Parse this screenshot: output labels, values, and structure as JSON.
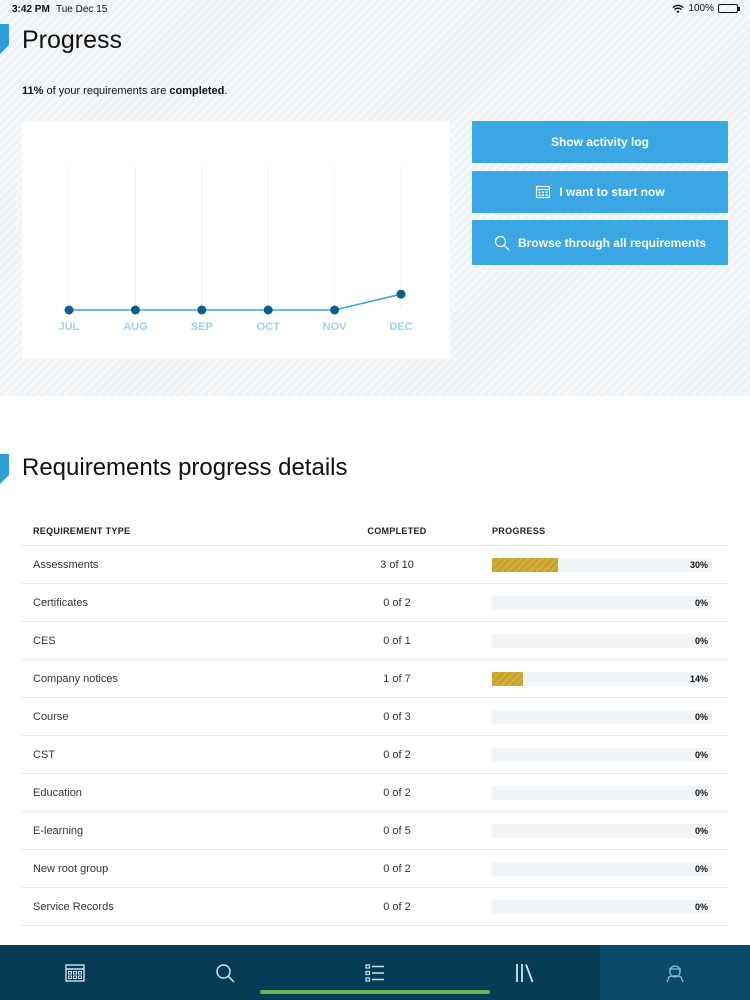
{
  "status_bar": {
    "time": "3:42 PM",
    "date": "Tue Dec 15",
    "battery": "100%"
  },
  "page": {
    "title": "Progress",
    "summary_percent": "11%",
    "summary_middle": " of your requirements are ",
    "summary_status": "completed",
    "summary_end": "."
  },
  "actions": {
    "activity_log": "Show activity log",
    "start_now": "I want to start now",
    "browse": "Browse through all requirements"
  },
  "chart_data": {
    "type": "line",
    "categories": [
      "JUL",
      "AUG",
      "SEP",
      "OCT",
      "NOV",
      "DEC"
    ],
    "values": [
      0,
      0,
      0,
      0,
      0,
      11
    ],
    "ylim": [
      0,
      100
    ],
    "grid": "vertical",
    "colors": {
      "line": "#3aa6e3",
      "point": "#0b5f8a",
      "label": "#9fd0ee",
      "grid": "#eceff2"
    }
  },
  "details": {
    "title": "Requirements progress details",
    "headers": {
      "type": "REQUIREMENT TYPE",
      "completed": "COMPLETED",
      "progress": "PROGRESS"
    },
    "rows": [
      {
        "type": "Assessments",
        "completed": "3 of 10",
        "percent": 30,
        "percent_label": "30%"
      },
      {
        "type": "Certificates",
        "completed": "0 of 2",
        "percent": 0,
        "percent_label": "0%"
      },
      {
        "type": "CES",
        "completed": "0 of 1",
        "percent": 0,
        "percent_label": "0%"
      },
      {
        "type": "Company notices",
        "completed": "1 of 7",
        "percent": 14,
        "percent_label": "14%"
      },
      {
        "type": "Course",
        "completed": "0 of 3",
        "percent": 0,
        "percent_label": "0%"
      },
      {
        "type": "CST",
        "completed": "0 of 2",
        "percent": 0,
        "percent_label": "0%"
      },
      {
        "type": "Education",
        "completed": "0 of 2",
        "percent": 0,
        "percent_label": "0%"
      },
      {
        "type": "E-learning",
        "completed": "0 of 5",
        "percent": 0,
        "percent_label": "0%"
      },
      {
        "type": "New root group",
        "completed": "0 of 2",
        "percent": 0,
        "percent_label": "0%"
      },
      {
        "type": "Service Records",
        "completed": "0 of 2",
        "percent": 0,
        "percent_label": "0%"
      }
    ]
  },
  "tabbar": {
    "items": [
      {
        "icon": "calendar-icon",
        "active": false
      },
      {
        "icon": "search-icon",
        "active": false
      },
      {
        "icon": "list-icon",
        "active": false
      },
      {
        "icon": "library-icon",
        "active": false
      },
      {
        "icon": "profile-icon",
        "active": true
      }
    ]
  },
  "colors": {
    "accent": "#3aa6e3",
    "tabbar": "#063b55",
    "progress_fill": "#c9a227"
  }
}
